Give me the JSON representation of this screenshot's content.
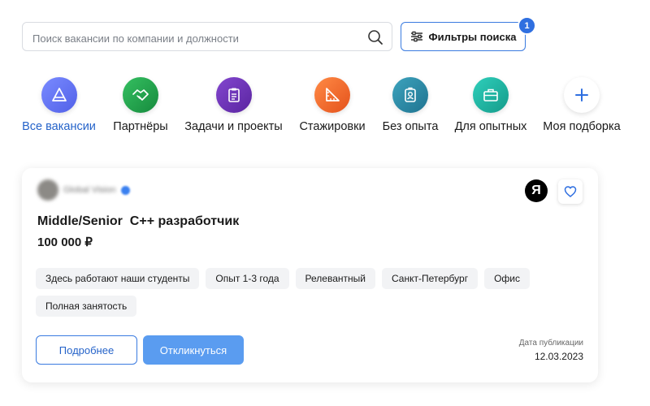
{
  "search": {
    "placeholder": "Поиск вакансии по компании и должности",
    "filters_label": "Фильтры поиска",
    "filters_count": "1"
  },
  "categories": [
    {
      "label": "Все вакансии",
      "active": true,
      "color": "#6677f5",
      "icon": "triangle-icon"
    },
    {
      "label": "Партнёры",
      "active": false,
      "color": "#21a04a",
      "icon": "handshake-icon"
    },
    {
      "label": "Задачи и проекты",
      "active": false,
      "color": "#6d35b8",
      "icon": "clipboard-icon"
    },
    {
      "label": "Стажировки",
      "active": false,
      "color": "#f26a2d",
      "icon": "ruler-icon"
    },
    {
      "label": "Без опыта",
      "active": false,
      "color": "#2f8ea8",
      "icon": "badge-icon"
    },
    {
      "label": "Для опытных",
      "active": false,
      "color": "#1fb5a3",
      "icon": "briefcase-icon"
    },
    {
      "label": "Моя подборка",
      "active": false,
      "color": "#ffffff",
      "icon": "plus-icon"
    }
  ],
  "vacancy": {
    "company": "Global Vision",
    "title": "Middle/Senior  C++ разработчик",
    "salary": "100 000 ₽",
    "yandex_logo": "Я",
    "tags": [
      "Здесь работают наши студенты",
      "Опыт 1-3 года",
      "Релевантный",
      "Санкт-Петербург",
      "Офис",
      "Полная занятость"
    ],
    "details_button": "Подробнее",
    "respond_button": "Откликнуться",
    "pub_label": "Дата публикации",
    "pub_date": "12.03.2023"
  }
}
